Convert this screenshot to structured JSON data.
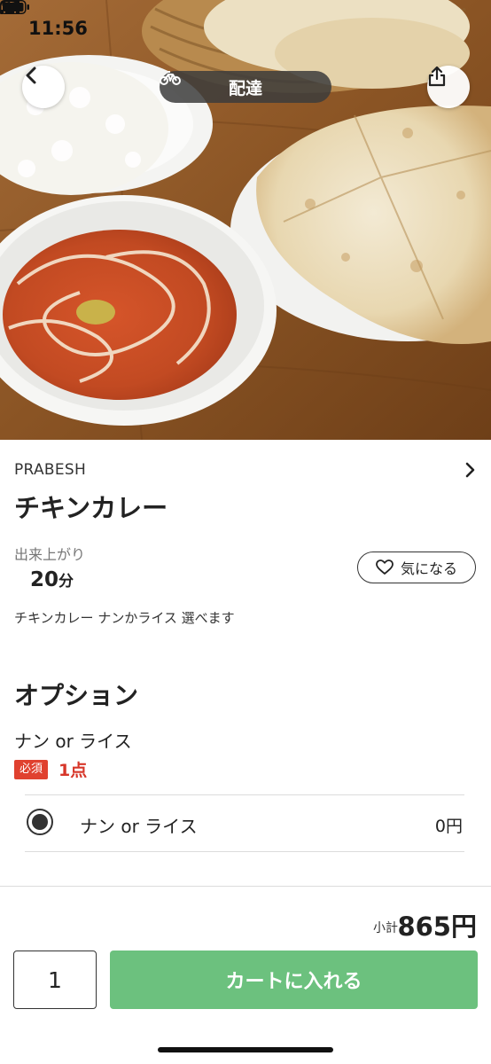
{
  "status_bar": {
    "time": "11:56",
    "icons": [
      "location-arrow-icon",
      "signal-icon",
      "wifi-icon",
      "battery-icon"
    ]
  },
  "header": {
    "delivery_label": "配達",
    "delivery_icon": "bicycle-icon",
    "back_icon": "chevron-left-icon",
    "share_icon": "share-icon"
  },
  "product": {
    "store_name": "PRABESH",
    "title": "チキンカレー",
    "ready_label": "出来上がり",
    "ready_minutes": "20",
    "ready_unit": "分",
    "favorite_label": "気になる",
    "description": "チキンカレー ナンかライス 選べます"
  },
  "options": {
    "section_title": "オプション",
    "group_name": "ナン or ライス",
    "required_badge": "必須",
    "required_count": "1点",
    "items": [
      {
        "label": "ナン or ライス",
        "price": "0円",
        "selected": true
      }
    ]
  },
  "footer": {
    "subtotal_label": "小計",
    "subtotal_value": "865円",
    "quantity": "1",
    "cart_button_label": "カートに入れる"
  },
  "colors": {
    "accent_green": "#6cc17e",
    "required_red": "#e0412f",
    "required_count_red": "#d7372a"
  }
}
